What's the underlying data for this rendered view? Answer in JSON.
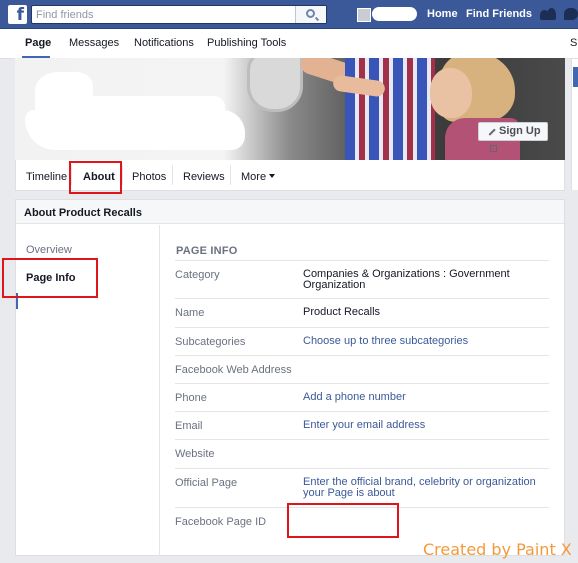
{
  "topbar": {
    "logo": "f",
    "search_placeholder": "Find friends",
    "nav": [
      "Home",
      "Find Friends"
    ]
  },
  "page_tabs": [
    "Page",
    "Messages",
    "Notifications",
    "Publishing Tools",
    "S"
  ],
  "cover": {
    "signup_label": "Sign Up"
  },
  "profile_tabs": [
    "Timeline",
    "About",
    "Photos",
    "Reviews",
    "More"
  ],
  "about": {
    "title": "About Product Recalls",
    "sidebar": [
      "Overview",
      "Page Info"
    ],
    "section_heading": "PAGE INFO",
    "rows": [
      {
        "label": "Category",
        "value": "Companies & Organizations : Government Organization",
        "link": false
      },
      {
        "label": "Name",
        "value": "Product Recalls",
        "link": false
      },
      {
        "label": "Subcategories",
        "value": "Choose up to three subcategories",
        "link": true
      },
      {
        "label": "Facebook Web Address",
        "value": "",
        "link": false
      },
      {
        "label": "Phone",
        "value": "Add a phone number",
        "link": true
      },
      {
        "label": "Email",
        "value": "Enter your email address",
        "link": true
      },
      {
        "label": "Website",
        "value": "",
        "link": false
      },
      {
        "label": "Official Page",
        "value": "Enter the official brand, celebrity or organization your Page is about",
        "link": true
      },
      {
        "label": "Facebook Page ID",
        "value": "",
        "link": false
      }
    ]
  },
  "watermark": "Created by Paint X",
  "colors": {
    "brand": "#3b5998",
    "link": "#3b5998",
    "annotation": "#e0141b",
    "watermark": "#f39a3c"
  }
}
